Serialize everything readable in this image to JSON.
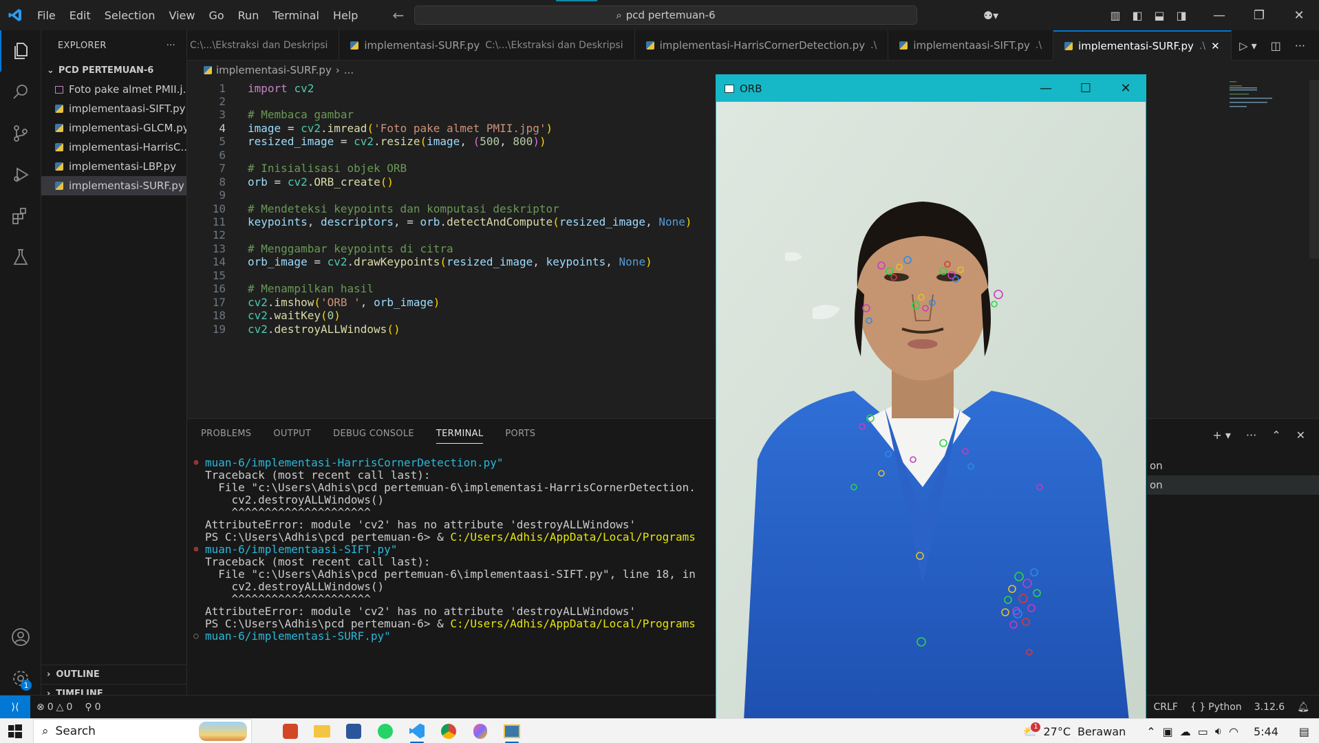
{
  "title_bar": {
    "menu": [
      "File",
      "Edit",
      "Selection",
      "View",
      "Go",
      "Run",
      "Terminal",
      "Help"
    ],
    "search_text": "pcd pertemuan-6"
  },
  "explorer": {
    "header": "EXPLORER",
    "folder": "PCD PERTEMUAN-6",
    "files": [
      {
        "name": "Foto pake almet PMII.j...",
        "type": "image"
      },
      {
        "name": "implementaasi-SIFT.py",
        "type": "python"
      },
      {
        "name": "implementasi-GLCM.py",
        "type": "python"
      },
      {
        "name": "implementasi-HarrisC...",
        "type": "python"
      },
      {
        "name": "implementasi-LBP.py",
        "type": "python"
      },
      {
        "name": "implementasi-SURF.py",
        "type": "python",
        "selected": true
      }
    ],
    "outline": "OUTLINE",
    "timeline": "TIMELINE"
  },
  "tabs": [
    {
      "label": "",
      "desc": "C:\\...\\Ekstraksi dan Deskripsi"
    },
    {
      "label": "implementasi-SURF.py",
      "desc": "C:\\...\\Ekstraksi dan Deskripsi"
    },
    {
      "label": "implementasi-HarrisCornerDetection.py",
      "desc": ".\\"
    },
    {
      "label": "implementaasi-SIFT.py",
      "desc": ".\\"
    },
    {
      "label": "implementasi-SURF.py",
      "desc": ".\\",
      "active": true
    }
  ],
  "breadcrumb": {
    "file": "implementasi-SURF.py",
    "rest": "..."
  },
  "code_lines": [
    "import cv2",
    "",
    "# Membaca gambar",
    "image = cv2.imread('Foto pake almet PMII.jpg')",
    "resized_image = cv2.resize(image, (500, 800))",
    "",
    "# Inisialisasi objek ORB",
    "orb = cv2.ORB_create()",
    "",
    "# Mendeteksi keypoints dan komputasi deskriptor",
    "keypoints, descriptors, = orb.detectAndCompute(resized_image, None)",
    "",
    "# Menggambar keypoints di citra",
    "orb_image = cv2.drawKeypoints(resized_image, keypoints, None)",
    "",
    "# Menampilkan hasil",
    "cv2.imshow('ORB ', orb_image)",
    "cv2.waitKey(0)",
    "cv2.destroyALLWindows()"
  ],
  "current_line": 4,
  "panel": {
    "tabs": [
      "PROBLEMS",
      "OUTPUT",
      "DEBUG CONSOLE",
      "TERMINAL",
      "PORTS"
    ],
    "active_tab": "TERMINAL",
    "terminal_lines": [
      {
        "marker": "err",
        "text": "muan-6/implementasi-HarrisCornerDetection.py\"",
        "style": "cy"
      },
      {
        "marker": "",
        "text": "Traceback (most recent call last):"
      },
      {
        "marker": "",
        "text": "  File \"c:\\Users\\Adhis\\pcd pertemuan-6\\implementasi-HarrisCornerDetection."
      },
      {
        "marker": "",
        "text": "    cv2.destroyALLWindows()"
      },
      {
        "marker": "",
        "text": "    ^^^^^^^^^^^^^^^^^^^^^"
      },
      {
        "marker": "",
        "text": "AttributeError: module 'cv2' has no attribute 'destroyALLWindows'"
      },
      {
        "marker": "",
        "text": "PS C:\\Users\\Adhis\\pcd pertemuan-6> & ",
        "yellow": "C:/Users/Adhis/AppData/Local/Programs"
      },
      {
        "marker": "err",
        "text": "muan-6/implementaasi-SIFT.py\"",
        "style": "cy"
      },
      {
        "marker": "",
        "text": "Traceback (most recent call last):"
      },
      {
        "marker": "",
        "text": "  File \"c:\\Users\\Adhis\\pcd pertemuan-6\\implementaasi-SIFT.py\", line 18, in"
      },
      {
        "marker": "",
        "text": "    cv2.destroyALLWindows()"
      },
      {
        "marker": "",
        "text": "    ^^^^^^^^^^^^^^^^^^^^^"
      },
      {
        "marker": "",
        "text": "AttributeError: module 'cv2' has no attribute 'destroyALLWindows'"
      },
      {
        "marker": "",
        "text": "PS C:\\Users\\Adhis\\pcd pertemuan-6> & ",
        "yellow": "C:/Users/Adhis/AppData/Local/Programs"
      },
      {
        "marker": "ok",
        "text": "muan-6/implementasi-SURF.py\"",
        "style": "cy"
      }
    ],
    "shells": [
      "on",
      "on"
    ]
  },
  "status_bar": {
    "errors": "0",
    "warnings": "0",
    "ports": "0",
    "eol": "CRLF",
    "language": "Python",
    "version": "3.12.6",
    "settings_badge": "1"
  },
  "orb_window": {
    "title": "ORB"
  },
  "taskbar": {
    "search": "Search",
    "weather_temp": "27°C",
    "weather_text": "Berawan",
    "weather_badge": "1",
    "time": "5:44"
  }
}
